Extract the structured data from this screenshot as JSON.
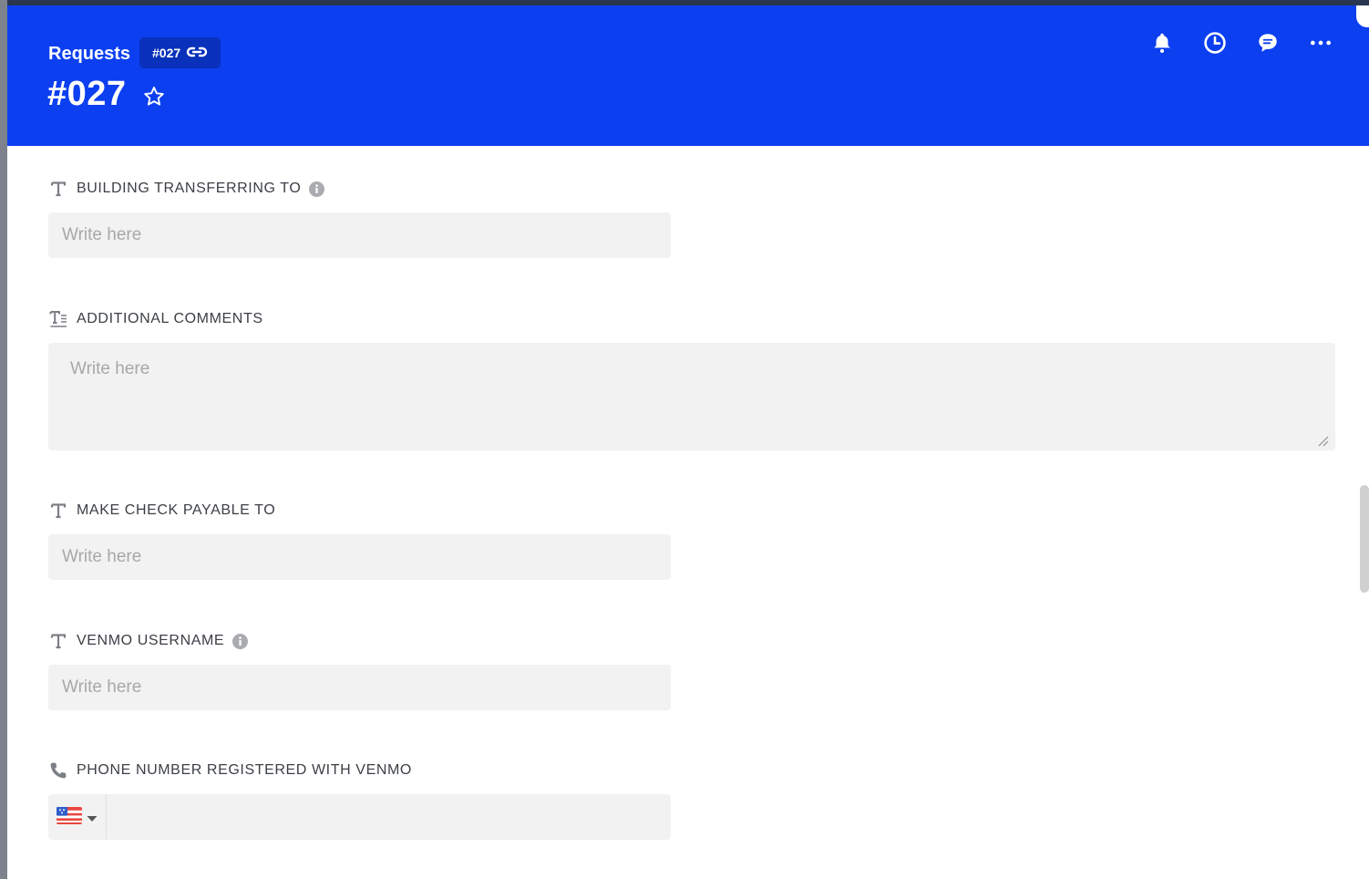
{
  "header": {
    "breadcrumb": "Requests",
    "record_badge": "#027",
    "title": "#027",
    "icons": [
      "bell-icon",
      "clock-icon",
      "comment-icon",
      "more-icon"
    ]
  },
  "fields": [
    {
      "label": "BUILDING TRANSFERRING TO",
      "type": "text",
      "placeholder": "Write here",
      "has_info": true
    },
    {
      "label": "ADDITIONAL COMMENTS",
      "type": "long-text",
      "placeholder": "Write here",
      "has_info": false
    },
    {
      "label": "MAKE CHECK PAYABLE TO",
      "type": "text",
      "placeholder": "Write here",
      "has_info": false
    },
    {
      "label": "VENMO USERNAME",
      "type": "text",
      "placeholder": "Write here",
      "has_info": true
    },
    {
      "label": "PHONE NUMBER REGISTERED WITH VENMO",
      "type": "phone",
      "country": "US",
      "value": ""
    }
  ],
  "colors": {
    "header_bg": "#0c3ff0",
    "input_bg": "#f2f2f2",
    "label": "#3b3f45",
    "placeholder": "#a8a8a8"
  }
}
